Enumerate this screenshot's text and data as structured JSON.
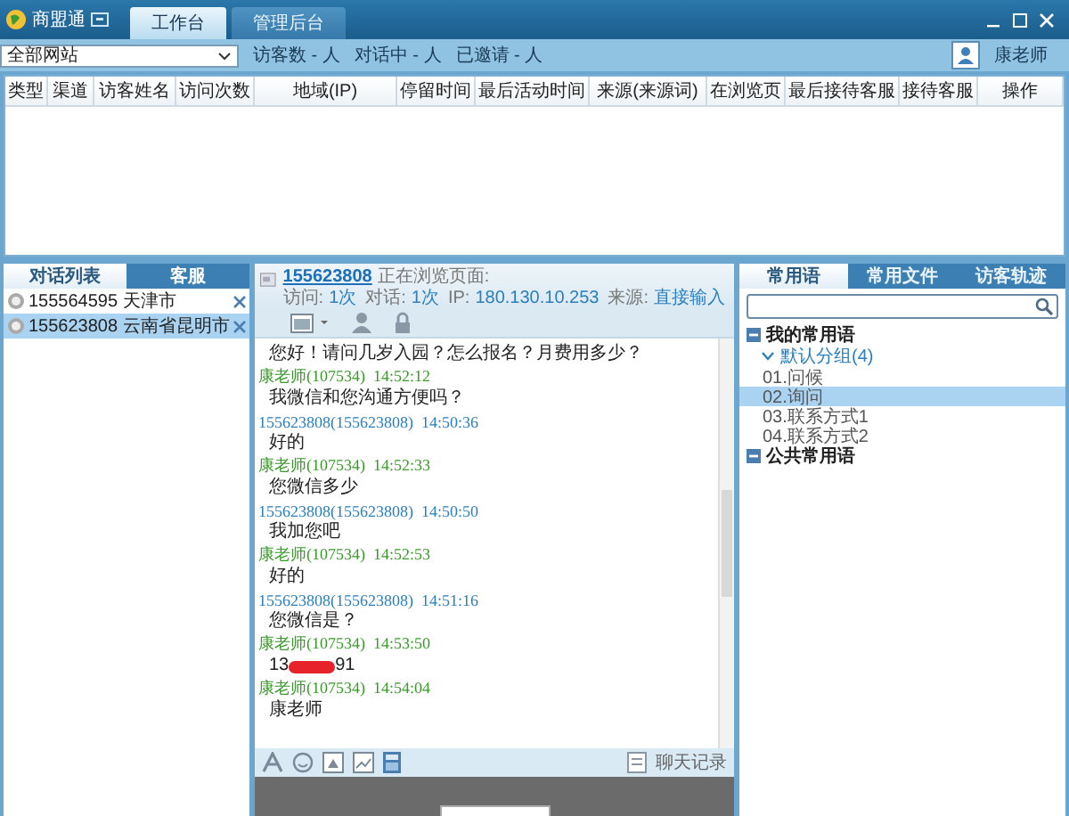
{
  "app": {
    "name": "商盟通"
  },
  "tabs": [
    {
      "label": "工作台",
      "selected": true
    },
    {
      "label": "管理后台",
      "selected": false
    }
  ],
  "toolbar": {
    "site_select": "全部网站",
    "stats": [
      "访客数 - 人",
      "对话中 - 人",
      "已邀请 - 人"
    ],
    "user": "康老师"
  },
  "table": {
    "columns": [
      "类型",
      "渠道",
      "访客姓名",
      "访问次数",
      "地域(IP)",
      "停留时间",
      "最后活动时间",
      "来源(来源词)",
      "在浏览页",
      "最后接待客服",
      "接待客服",
      "操作"
    ]
  },
  "left_panel": {
    "tabs": [
      {
        "label": "对话列表",
        "selected": true
      },
      {
        "label": "客服",
        "selected": false
      }
    ],
    "items": [
      {
        "text": "155564595 天津市",
        "selected": false
      },
      {
        "text": "155623808 云南省昆明市",
        "selected": true
      }
    ]
  },
  "chat": {
    "visitor": "155623808",
    "browsing": "正在浏览页面:",
    "info": [
      {
        "label": "访问:",
        "value": "1次"
      },
      {
        "label": "对话:",
        "value": "1次"
      },
      {
        "label": "IP:",
        "value": "180.130.10.253"
      },
      {
        "label": "来源:",
        "value": "直接输入"
      }
    ],
    "messages": [
      {
        "text": "您好！请问几岁入园？怎么报名？月费用多少？"
      },
      {
        "kind": "agent",
        "sender": "康老师(107534)",
        "time": "14:52:12",
        "text": "我微信和您沟通方便吗？"
      },
      {
        "kind": "visitor",
        "sender": "155623808(155623808)",
        "time": "14:50:36",
        "text": "好的"
      },
      {
        "kind": "agent",
        "sender": "康老师(107534)",
        "time": "14:52:33",
        "text": "您微信多少"
      },
      {
        "kind": "visitor",
        "sender": "155623808(155623808)",
        "time": "14:50:50",
        "text": "我加您吧"
      },
      {
        "kind": "agent",
        "sender": "康老师(107534)",
        "time": "14:52:53",
        "text": "好的"
      },
      {
        "kind": "visitor",
        "sender": "155623808(155623808)",
        "time": "14:51:16",
        "text": "您微信是？"
      },
      {
        "kind": "agent",
        "sender": "康老师(107534)",
        "time": "14:53:50",
        "text": "13",
        "text_end": "91"
      },
      {
        "kind": "agent",
        "sender": "康老师(107534)",
        "time": "14:54:04",
        "text": "康老师"
      }
    ],
    "history": "聊天记录"
  },
  "right_panel": {
    "tabs": [
      {
        "label": "常用语",
        "selected": true
      },
      {
        "label": "常用文件",
        "selected": false
      },
      {
        "label": "访客轨迹",
        "selected": false
      }
    ],
    "tree": [
      {
        "label": "我的常用语",
        "expanded": true,
        "children": [
          {
            "label": "默认分组(4)",
            "expanded": true,
            "children": [
              {
                "label": "01.问候",
                "selected": false
              },
              {
                "label": "02.询问",
                "selected": true
              },
              {
                "label": "03.联系方式1",
                "selected": false
              },
              {
                "label": "04.联系方式2",
                "selected": false
              }
            ]
          }
        ]
      },
      {
        "label": "公共常用语",
        "expanded": true
      }
    ]
  }
}
